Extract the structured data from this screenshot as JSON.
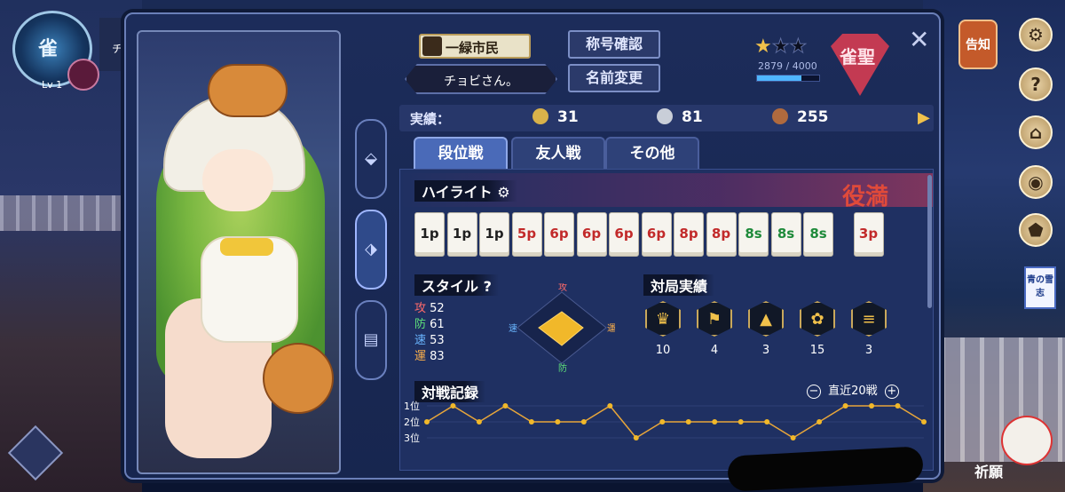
{
  "topleft": {
    "rank_glyph": "雀",
    "level": "Lv 1",
    "name_fragment": "チ"
  },
  "header": {
    "title": "一緑市民",
    "player_name": "チョビさん。",
    "btn_title_check": "称号確認",
    "btn_rename": "名前変更",
    "stars_filled": 1,
    "stars_total": 3,
    "exp_text": "2879 / 4000",
    "exp_ratio": 0.7198,
    "rank_name": "雀聖",
    "close_label": "✕"
  },
  "achievements": {
    "label": "実績：",
    "items": [
      {
        "name": "gold-medal",
        "color": "#d9b24a",
        "value": "31"
      },
      {
        "name": "silver-medal",
        "color": "#c9ced8",
        "value": "81"
      },
      {
        "name": "bronze-medal",
        "color": "#b06a3e",
        "value": "255"
      }
    ],
    "more_label": "▶"
  },
  "tabs": [
    {
      "label": "段位戦",
      "active": true
    },
    {
      "label": "友人戦",
      "active": false
    },
    {
      "label": "その他",
      "active": false
    }
  ],
  "highlight": {
    "title": "ハイライト",
    "result": "役満",
    "tiles": [
      {
        "t": "1p",
        "k": "wheel"
      },
      {
        "t": "1p",
        "k": "wheel"
      },
      {
        "t": "1p",
        "k": "wheel"
      },
      {
        "t": "5p",
        "k": "pin"
      },
      {
        "t": "6p",
        "k": "pin"
      },
      {
        "t": "6p",
        "k": "pin"
      },
      {
        "t": "6p",
        "k": "pin"
      },
      {
        "t": "6p",
        "k": "pin"
      },
      {
        "t": "8p",
        "k": "pin"
      },
      {
        "t": "8p",
        "k": "pin"
      },
      {
        "t": "8s",
        "k": "sou"
      },
      {
        "t": "8s",
        "k": "sou"
      },
      {
        "t": "8s",
        "k": "sou"
      },
      {
        "t": "3p",
        "k": "pin"
      }
    ]
  },
  "style": {
    "title": "スタイル",
    "help": "?",
    "stats": [
      {
        "label": "攻",
        "value": "52",
        "color": "#ff6a6a"
      },
      {
        "label": "防",
        "value": "61",
        "color": "#5ee07a"
      },
      {
        "label": "速",
        "value": "53",
        "color": "#6ab6ff"
      },
      {
        "label": "運",
        "value": "83",
        "color": "#ffb14a"
      }
    ],
    "axes": {
      "top": "攻",
      "right": "運",
      "bottom": "防",
      "left": "速"
    }
  },
  "record": {
    "title": "対局実績",
    "badges": [
      {
        "icon": "crown-icon",
        "glyph": "♛",
        "value": "10"
      },
      {
        "icon": "flag-icon",
        "glyph": "⚑",
        "value": "4"
      },
      {
        "icon": "rocket-icon",
        "glyph": "▲",
        "value": "3"
      },
      {
        "icon": "lotus-icon",
        "glyph": "✿",
        "value": "15"
      },
      {
        "icon": "tiles-icon",
        "glyph": "≡",
        "value": "3"
      }
    ]
  },
  "history": {
    "title": "対戦記録",
    "range_label": "直近20戦",
    "minus": "−",
    "plus": "+",
    "y_labels": [
      "1位",
      "2位",
      "3位"
    ]
  },
  "chart_data": {
    "type": "line",
    "title": "",
    "y_categories": [
      "1位",
      "2位",
      "3位"
    ],
    "values": [
      2,
      1,
      2,
      1,
      2,
      2,
      2,
      1,
      3,
      2,
      2,
      2,
      2,
      2,
      3,
      2,
      1,
      1,
      1,
      2
    ]
  },
  "right_column": {
    "notice_label": "告知",
    "ad_label": "青の雪志",
    "pray_label": "祈願"
  }
}
